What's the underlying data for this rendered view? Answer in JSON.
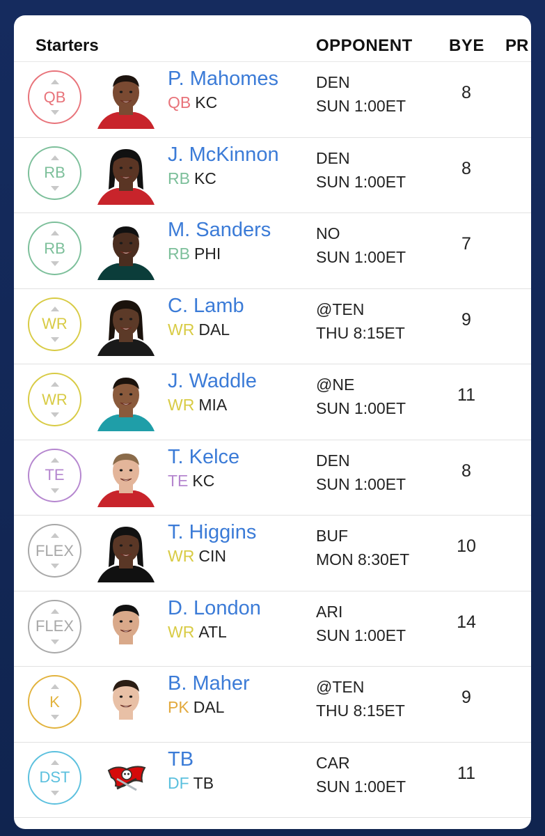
{
  "header": {
    "starters": "Starters",
    "opponent": "OPPONENT",
    "bye": "BYE",
    "pr": "PR"
  },
  "colors": {
    "qb": "#e8737a",
    "rb": "#7cbf9a",
    "wr": "#d8cb44",
    "te": "#b586cf",
    "flex": "#a8a8a8",
    "k": "#e2b33d",
    "dst": "#5bc0de",
    "pk": "#e2a93d",
    "df": "#5bc0de"
  },
  "rows": [
    {
      "slot": "QB",
      "slot_color": "#e8737a",
      "name": "P. Mahomes",
      "pos": "QB",
      "pos_color": "#e8737a",
      "team": "KC",
      "opp1": "DEN",
      "opp2": "SUN 1:00ET",
      "bye": "8",
      "photo": "player-photo"
    },
    {
      "slot": "RB",
      "slot_color": "#7cbf9a",
      "name": "J. McKinnon",
      "pos": "RB",
      "pos_color": "#7cbf9a",
      "team": "KC",
      "opp1": "DEN",
      "opp2": "SUN 1:00ET",
      "bye": "8",
      "photo": "player-photo"
    },
    {
      "slot": "RB",
      "slot_color": "#7cbf9a",
      "name": "M. Sanders",
      "pos": "RB",
      "pos_color": "#7cbf9a",
      "team": "PHI",
      "opp1": "NO",
      "opp2": "SUN 1:00ET",
      "bye": "7",
      "photo": "player-photo"
    },
    {
      "slot": "WR",
      "slot_color": "#d8cb44",
      "name": "C. Lamb",
      "pos": "WR",
      "pos_color": "#d8cb44",
      "team": "DAL",
      "opp1": "@TEN",
      "opp2": "THU 8:15ET",
      "bye": "9",
      "photo": "player-photo"
    },
    {
      "slot": "WR",
      "slot_color": "#d8cb44",
      "name": "J. Waddle",
      "pos": "WR",
      "pos_color": "#d8cb44",
      "team": "MIA",
      "opp1": "@NE",
      "opp2": "SUN 1:00ET",
      "bye": "11",
      "photo": "player-photo"
    },
    {
      "slot": "TE",
      "slot_color": "#b586cf",
      "name": "T. Kelce",
      "pos": "TE",
      "pos_color": "#b586cf",
      "team": "KC",
      "opp1": "DEN",
      "opp2": "SUN 1:00ET",
      "bye": "8",
      "photo": "player-photo"
    },
    {
      "slot": "FLEX",
      "slot_color": "#a8a8a8",
      "name": "T. Higgins",
      "pos": "WR",
      "pos_color": "#d8cb44",
      "team": "CIN",
      "opp1": "BUF",
      "opp2": "MON 8:30ET",
      "bye": "10",
      "photo": "player-photo"
    },
    {
      "slot": "FLEX",
      "slot_color": "#a8a8a8",
      "name": "D. London",
      "pos": "WR",
      "pos_color": "#d8cb44",
      "team": "ATL",
      "opp1": "ARI",
      "opp2": "SUN 1:00ET",
      "bye": "14",
      "photo": "player-photo"
    },
    {
      "slot": "K",
      "slot_color": "#e2b33d",
      "name": "B. Maher",
      "pos": "PK",
      "pos_color": "#e2a93d",
      "team": "DAL",
      "opp1": "@TEN",
      "opp2": "THU 8:15ET",
      "bye": "9",
      "photo": "player-photo"
    },
    {
      "slot": "DST",
      "slot_color": "#5bc0de",
      "name": "TB",
      "pos": "DF",
      "pos_color": "#5bc0de",
      "team": "TB",
      "opp1": "CAR",
      "opp2": "SUN 1:00ET",
      "bye": "11",
      "photo": "team-logo"
    }
  ]
}
